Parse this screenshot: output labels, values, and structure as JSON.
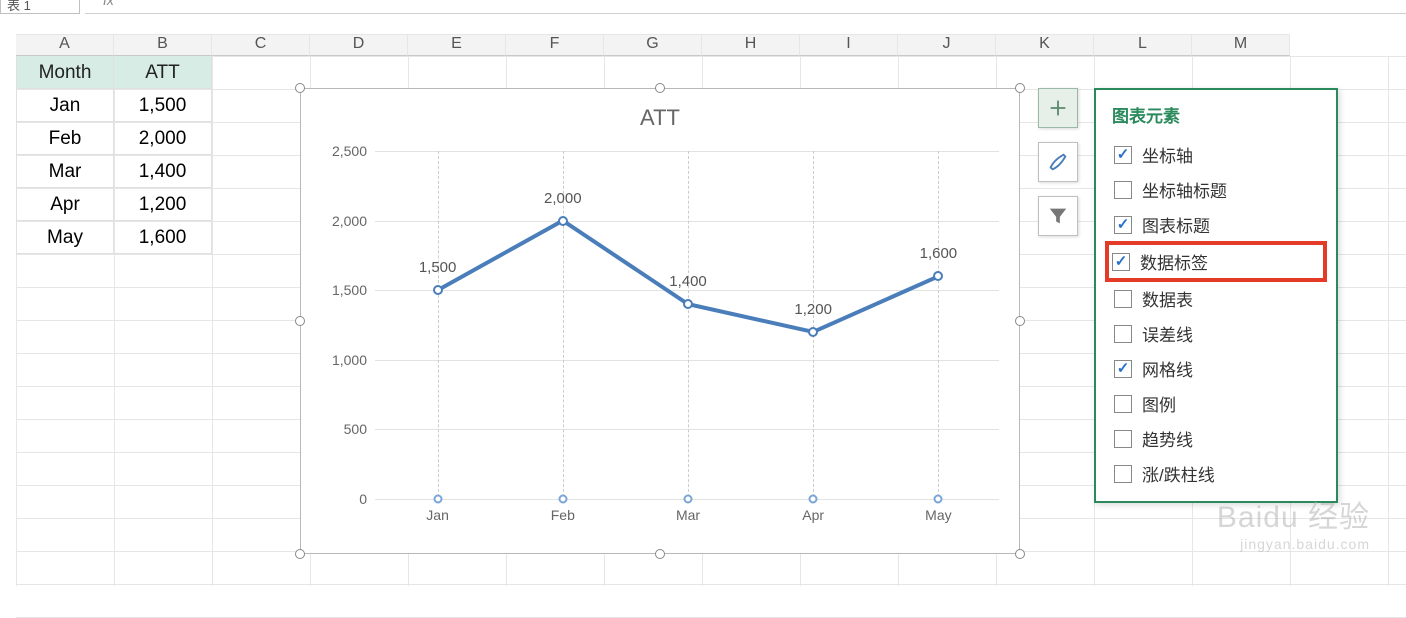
{
  "name_box": "表 1",
  "fx_symbol": "fx",
  "columns": [
    "A",
    "B",
    "C",
    "D",
    "E",
    "F",
    "G",
    "H",
    "I",
    "J",
    "K",
    "L",
    "M"
  ],
  "table": {
    "headers": [
      "Month",
      "ATT"
    ],
    "rows": [
      {
        "month": "Jan",
        "att": "1,500"
      },
      {
        "month": "Feb",
        "att": "2,000"
      },
      {
        "month": "Mar",
        "att": "1,400"
      },
      {
        "month": "Apr",
        "att": "1,200"
      },
      {
        "month": "May",
        "att": "1,600"
      }
    ]
  },
  "chart_data": {
    "type": "line",
    "title": "ATT",
    "xlabel": "",
    "ylabel": "",
    "categories": [
      "Jan",
      "Feb",
      "Mar",
      "Apr",
      "May"
    ],
    "values": [
      1500,
      2000,
      1400,
      1200,
      1600
    ],
    "data_labels": [
      "1,500",
      "2,000",
      "1,400",
      "1,200",
      "1,600"
    ],
    "yticks": [
      0,
      500,
      1000,
      1500,
      2000,
      2500
    ],
    "ytick_labels": [
      "0",
      "500",
      "1,000",
      "1,500",
      "2,000",
      "2,500"
    ],
    "ylim": [
      0,
      2500
    ],
    "grid": true,
    "drop_lines": true,
    "legend": false,
    "line_color": "#4a7ebb"
  },
  "side_buttons": {
    "plus": "plus-icon",
    "brush": "brush-icon",
    "funnel": "funnel-icon"
  },
  "elements_panel": {
    "title": "图表元素",
    "items": [
      {
        "label": "坐标轴",
        "checked": true
      },
      {
        "label": "坐标轴标题",
        "checked": false
      },
      {
        "label": "图表标题",
        "checked": true
      },
      {
        "label": "数据标签",
        "checked": true,
        "highlight": true
      },
      {
        "label": "数据表",
        "checked": false
      },
      {
        "label": "误差线",
        "checked": false
      },
      {
        "label": "网格线",
        "checked": true
      },
      {
        "label": "图例",
        "checked": false
      },
      {
        "label": "趋势线",
        "checked": false
      },
      {
        "label": "涨/跌柱线",
        "checked": false
      }
    ]
  },
  "watermark": {
    "main": "Baidu 经验",
    "sub": "jingyan.baidu.com"
  }
}
